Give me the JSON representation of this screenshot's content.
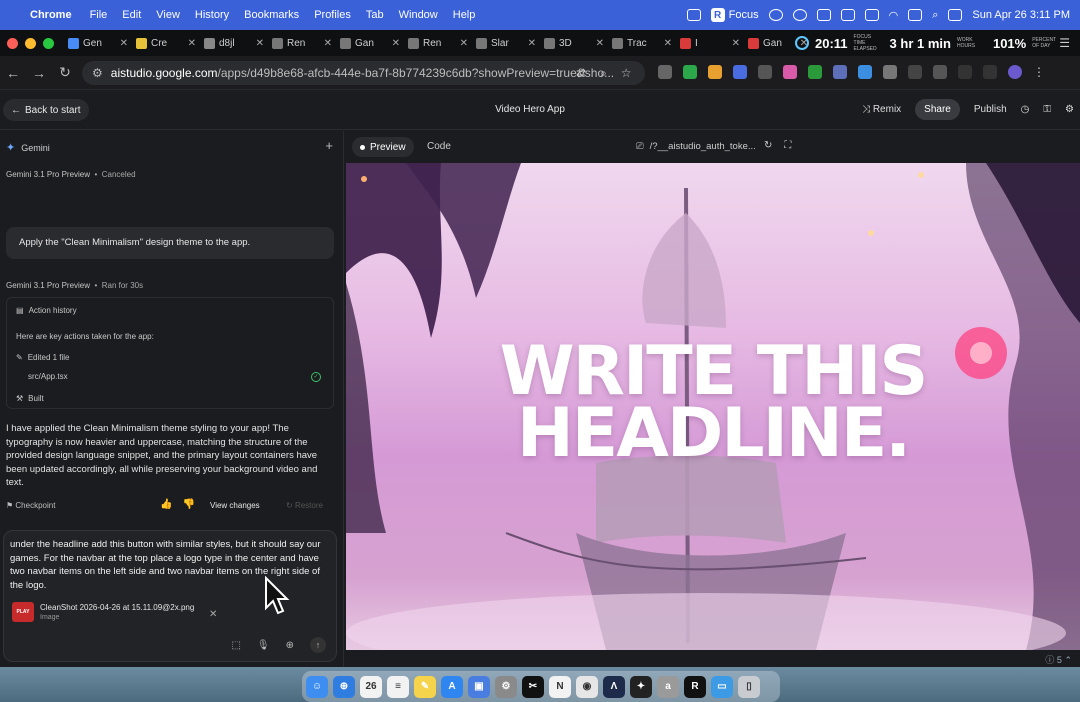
{
  "menubar": {
    "app": "Chrome",
    "items": [
      "File",
      "Edit",
      "View",
      "History",
      "Bookmarks",
      "Profiles",
      "Tab",
      "Window",
      "Help"
    ],
    "focus_label": "Focus",
    "datetime": "Sun Apr 26  3:11 PM"
  },
  "tabs": [
    {
      "title": "Gen",
      "color": "#4a8cf7"
    },
    {
      "title": "Cre",
      "color": "#e6c23a"
    },
    {
      "title": "d8jl",
      "color": "#888888"
    },
    {
      "title": "Ren",
      "color": "#777777"
    },
    {
      "title": "Gan",
      "color": "#777777"
    },
    {
      "title": "Ren",
      "color": "#777777"
    },
    {
      "title": "Slar",
      "color": "#777777"
    },
    {
      "title": "3D",
      "color": "#777777"
    },
    {
      "title": "Trac",
      "color": "#777777"
    },
    {
      "title": "I",
      "color": "#d93a3a"
    },
    {
      "title": "Gan",
      "color": "#d93a3a"
    }
  ],
  "focus_widget": {
    "elapsed": "20:11",
    "elapsed_label": "FOCUS TIME ELAPSED",
    "work": "3 hr 1 min",
    "work_label": "WORK HOURS",
    "pct": "101%",
    "pct_label": "PERCENT OF DAY"
  },
  "address": {
    "host": "aistudio.google.com",
    "path": "/apps/d49b8e68-afcb-444e-ba7f-8b774239c6db?showPreview=true&sho..."
  },
  "header": {
    "back_label": "Back to start",
    "title": "Video Hero App",
    "remix": "Remix",
    "share": "Share",
    "publish": "Publish"
  },
  "chat": {
    "panel_title": "Gemini",
    "run1_model": "Gemini 3.1 Pro Preview",
    "run1_status": "Canceled",
    "user_message": "Apply the \"Clean Minimalism\" design theme to the app.",
    "run2_model": "Gemini 3.1 Pro Preview",
    "run2_status": "Ran for 30s",
    "action_history_label": "Action history",
    "action_intro": "Here are key actions taken for the app:",
    "edited_label": "Edited 1 file",
    "edited_file": "src/App.tsx",
    "built_label": "Built",
    "response": "I have applied the Clean Minimalism theme styling to your app! The typography is now heavier and uppercase, matching the structure of the provided design language snippet, and the primary layout containers have been updated accordingly, all while preserving your background video and text.",
    "checkpoint_label": "Checkpoint",
    "view_changes_label": "View changes",
    "restore_label": "Restore",
    "draft": "under the headline add this button with similar styles, but it should say our games. For the navbar at the top place a logo type in the center and have two navbar items on the left side and two navbar items on the right side of the logo.",
    "attachment_name": "CleanShot 2026-04-26 at 15.11.09@2x.png",
    "attachment_type": "Image",
    "attachment_thumb_text": "PLAY"
  },
  "preview": {
    "tab_preview": "Preview",
    "tab_code": "Code",
    "route": "/?__aistudio_auth_toke...",
    "headline_line1": "WRITE THIS",
    "headline_line2": "HEADLINE.",
    "issue_count": "5"
  },
  "dock": {
    "apps": [
      {
        "name": "finder",
        "color": "#3d8ef0",
        "glyph": "☺"
      },
      {
        "name": "safari",
        "color": "#2f7de0",
        "glyph": "⊕"
      },
      {
        "name": "calendar",
        "color": "#f2f2f2",
        "glyph": "26"
      },
      {
        "name": "reminders",
        "color": "#f2f2f2",
        "glyph": "≡"
      },
      {
        "name": "notes",
        "color": "#f5d34a",
        "glyph": "✎"
      },
      {
        "name": "app-store",
        "color": "#2f86f0",
        "glyph": "A"
      },
      {
        "name": "preview",
        "color": "#4a7de0",
        "glyph": "▣"
      },
      {
        "name": "settings",
        "color": "#8a8a8a",
        "glyph": "⚙"
      },
      {
        "name": "capcut",
        "color": "#111111",
        "glyph": "✂"
      },
      {
        "name": "notion",
        "color": "#f2f2f2",
        "glyph": "N"
      },
      {
        "name": "chrome",
        "color": "#e6e6e6",
        "glyph": "◉"
      },
      {
        "name": "affinity",
        "color": "#1d2a4a",
        "glyph": "Λ"
      },
      {
        "name": "figma",
        "color": "#222222",
        "glyph": "✦"
      },
      {
        "name": "a-app",
        "color": "#9a9a9a",
        "glyph": "a"
      },
      {
        "name": "r-app",
        "color": "#111111",
        "glyph": "R"
      },
      {
        "name": "folder",
        "color": "#3d9be6",
        "glyph": "▭"
      },
      {
        "name": "trash",
        "color": "#c8ccd0",
        "glyph": "▯"
      }
    ]
  }
}
